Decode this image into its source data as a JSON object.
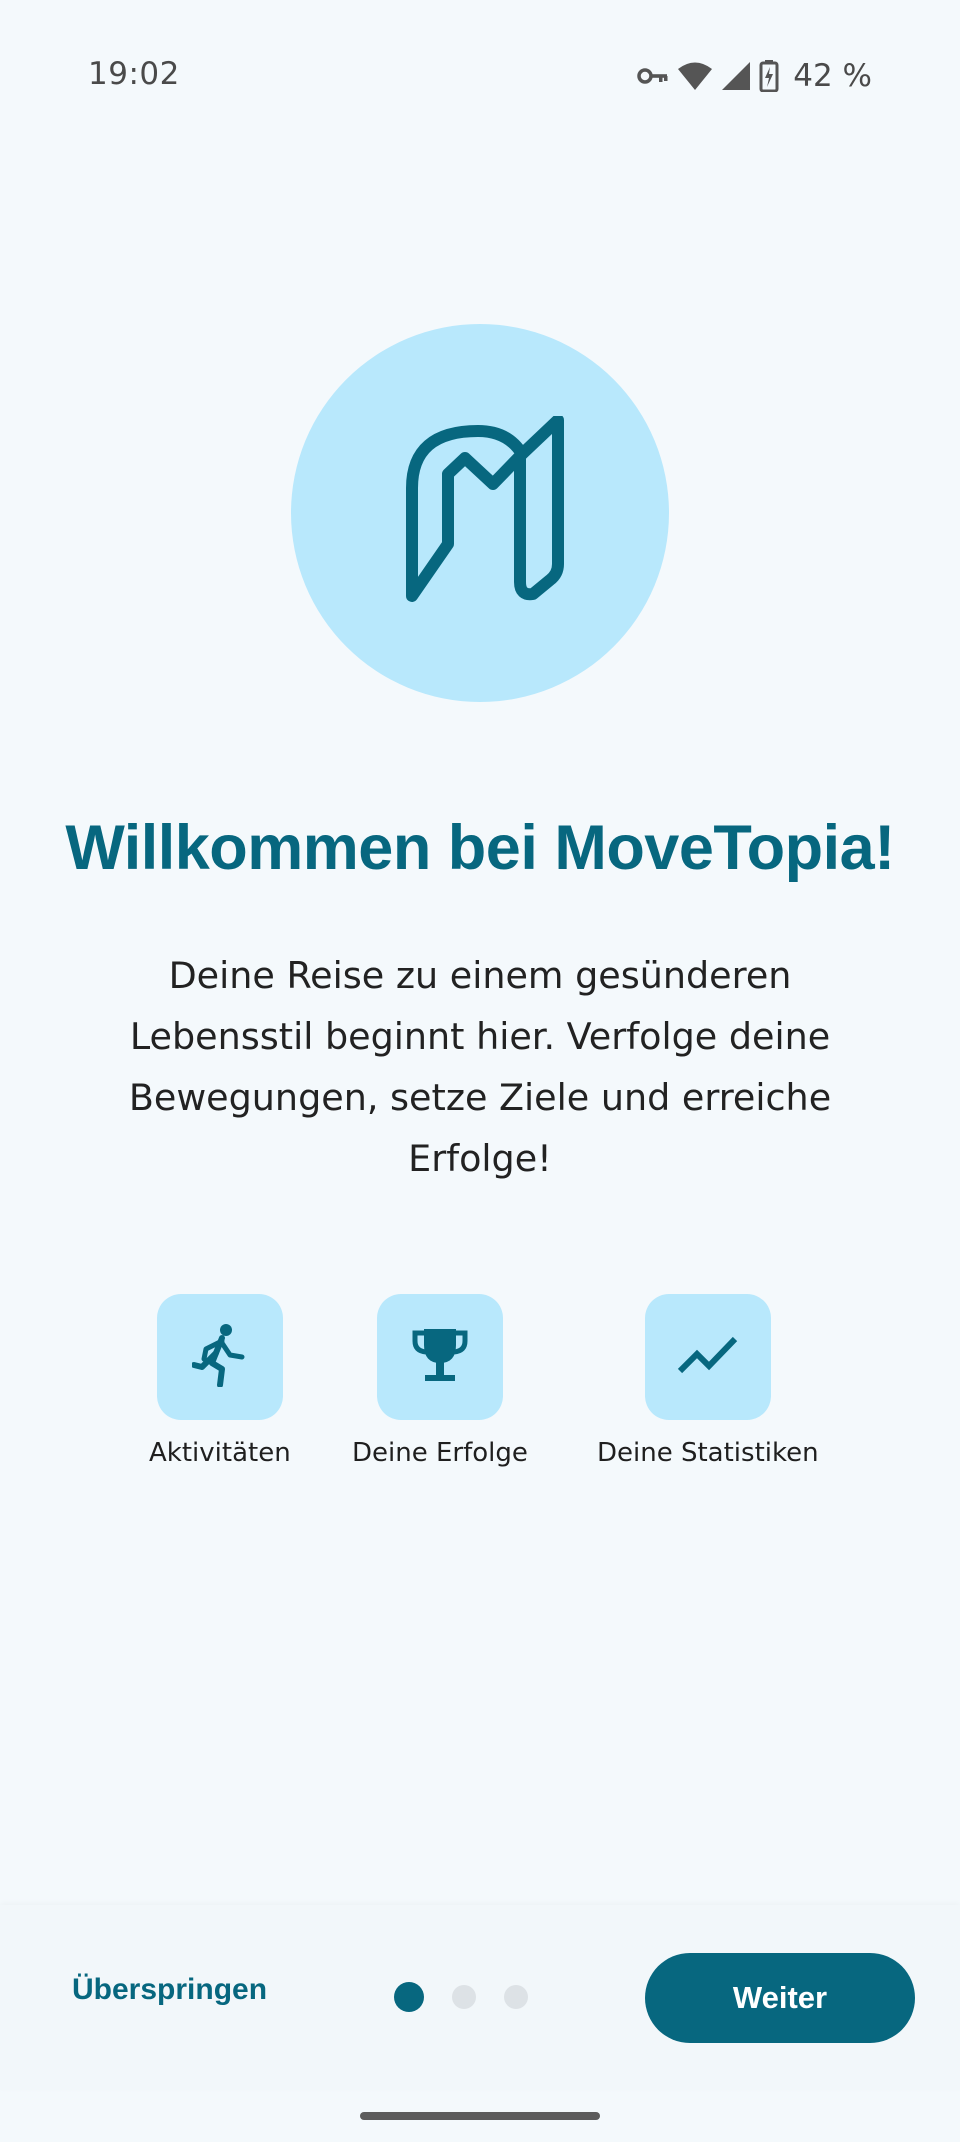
{
  "status_bar": {
    "time": "19:02",
    "battery": "42 %",
    "icons": [
      "vpn-key-icon",
      "wifi-icon",
      "cell-signal-icon",
      "battery-charging-icon"
    ]
  },
  "logo": {
    "icon": "movetopia-logo-icon",
    "color": "#07677f",
    "background": "#b8e8fc"
  },
  "welcome": {
    "title": "Willkommen bei MoveTopia!",
    "description": "Deine Reise zu einem gesünderen Lebensstil beginnt hier. Verfolge deine Bewegungen, setze Ziele und erreiche Erfolge!"
  },
  "features": [
    {
      "icon": "running-icon",
      "label": "Aktivitäten"
    },
    {
      "icon": "trophy-icon",
      "label": "Deine Erfolge"
    },
    {
      "icon": "trending-up-icon",
      "label": "Deine Statistiken"
    }
  ],
  "navigation": {
    "skip_label": "Überspringen",
    "next_label": "Weiter",
    "page_count": 3,
    "current_page": 1
  },
  "colors": {
    "primary": "#07677f",
    "tile": "#b8e8fc",
    "background": "#f4f9fc",
    "dot_inactive": "#dde2e6"
  }
}
